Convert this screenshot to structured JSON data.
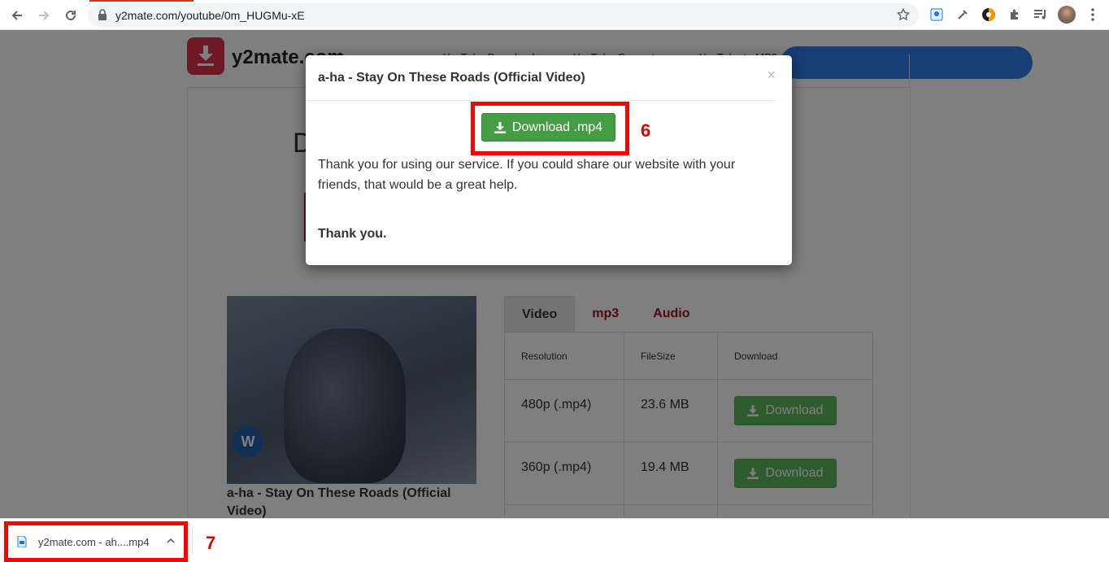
{
  "browser": {
    "url": "y2mate.com/youtube/0m_HUGMu-xE"
  },
  "site": {
    "logo_text": "y2mate.com",
    "nav_links": [
      "YouTube Downloader",
      "YouTube Converter",
      "YouTube to MP3"
    ]
  },
  "video": {
    "title": "a-ha - Stay On These Roads (Official Video)",
    "tabs": [
      {
        "label": "Video",
        "active": true
      },
      {
        "label": "mp3",
        "active": false
      },
      {
        "label": "Audio",
        "active": false
      }
    ],
    "table": {
      "headers": [
        "Resolution",
        "FileSize",
        "Download"
      ],
      "rows": [
        {
          "resolution": "480p (.mp4)",
          "size": "23.6 MB",
          "button": "Download"
        },
        {
          "resolution": "360p (.mp4)",
          "size": "19.4 MB",
          "button": "Download"
        }
      ]
    }
  },
  "modal": {
    "title": "a-ha - Stay On These Roads (Official Video)",
    "close": "×",
    "download_label": "Download .mp4",
    "message": "Thank you for using our service. If you could share our website with your friends, that would be a great help.",
    "thanks": "Thank you."
  },
  "annotations": {
    "step6": "6",
    "step7": "7"
  },
  "download_shelf": {
    "file_name": "y2mate.com - ah....mp4"
  },
  "colors": {
    "download_green": "#5cb85c",
    "tab_accent": "#a0122b",
    "highlight_red": "#ff0000"
  }
}
